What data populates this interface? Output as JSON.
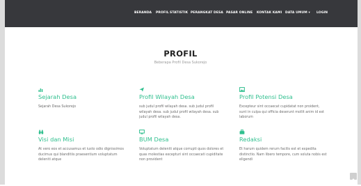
{
  "nav": {
    "items": [
      "BERANDA",
      "PROFIL",
      "STATISTIK",
      "PERANGKAT DESA",
      "PASAR ONLINE",
      "KONTAK KAMI",
      "DATA UMUM ▾",
      "LOGIN"
    ]
  },
  "section": {
    "title": "PROFIL",
    "subtitle": "Beberapa Profil Desa Sukorejo"
  },
  "features": [
    {
      "icon": "bar-chart-icon",
      "title": "Sejarah Desa",
      "text": "Sejarah Desa Sukorejo"
    },
    {
      "icon": "send-icon",
      "title": "Profil Wilayah Desa",
      "text": "sub judul profil wilayah desa. sub judul profil wilayah desa. sub judul profil wilayah desa. sub judul profil wilayah desa."
    },
    {
      "icon": "image-icon",
      "title": "Profil Potensi Desa",
      "text": "Excepteur sint occaecat cupidatat non proident, sunt in culpa qui officia deserunt mollit anim id est laborum"
    },
    {
      "icon": "binoculars-icon",
      "title": "Visi dan Misi",
      "text": "At vero eos et accusamus et iusto odio dignissimos ducimus qui blanditiis praesentium voluptatum deleniti atque"
    },
    {
      "icon": "monitor-icon",
      "title": "BUM Desa",
      "text": "Voluptatum deleniti atque corrupti quos dolores et quas molestias excepturi sint occaecati cupiditate non provident"
    },
    {
      "icon": "briefcase-icon",
      "title": "Redaksi",
      "text": "Et harum quidem rerum facilis est et expedita distinctio. Nam libero tempore, cum soluta nobis est eligendi"
    }
  ],
  "colors": {
    "accent": "#2fbf8e",
    "topbar": "#37383c",
    "body_text": "#6b6b6b"
  },
  "scroll_top": {
    "icon": "chevron-up-icon"
  }
}
